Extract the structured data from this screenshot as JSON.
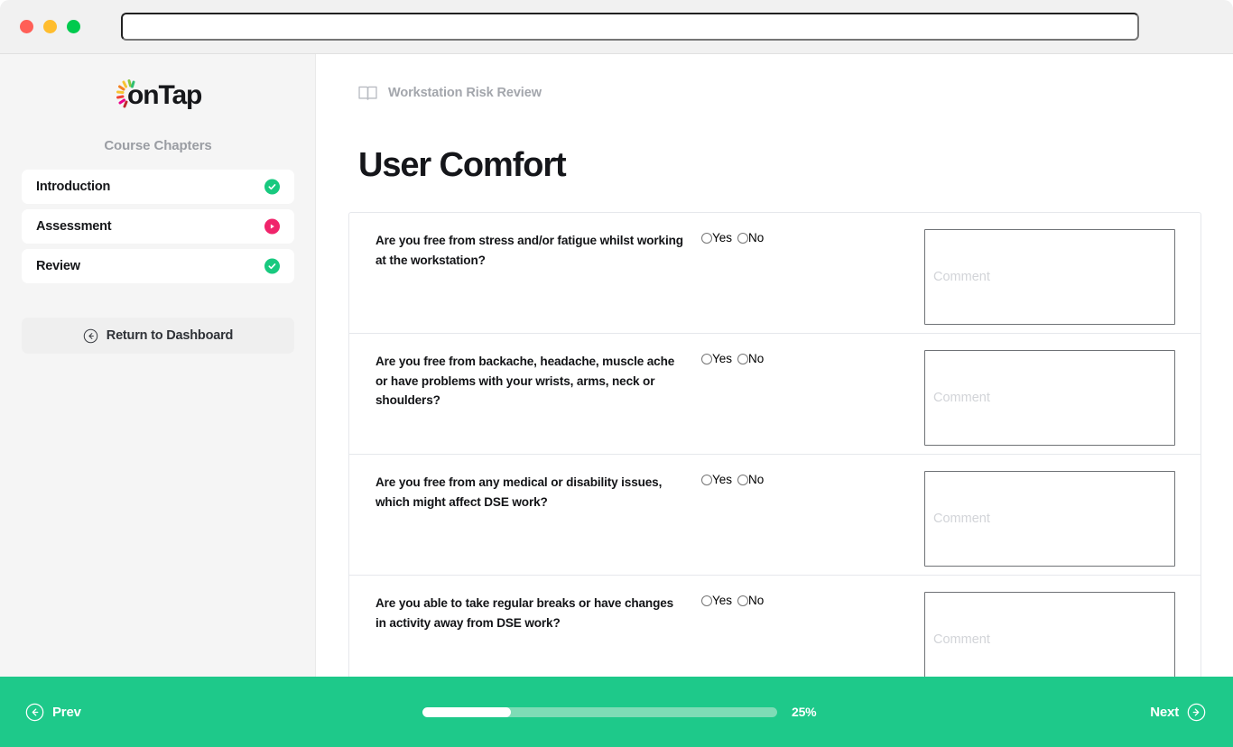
{
  "browser": {
    "traffic_lights": [
      {
        "name": "close",
        "color": "#FF5F57"
      },
      {
        "name": "minimize",
        "color": "#FFBD2E"
      },
      {
        "name": "maximize",
        "color": "#00CA4E"
      }
    ],
    "url_value": "",
    "url_placeholder": ""
  },
  "sidebar": {
    "logo_text": "onTap",
    "heading": "Course Chapters",
    "chapters": [
      {
        "label": "Introduction",
        "status": "complete",
        "status_icon": "check-circle-icon"
      },
      {
        "label": "Assessment",
        "status": "in-progress",
        "status_icon": "play-circle-icon"
      },
      {
        "label": "Review",
        "status": "complete",
        "status_icon": "check-circle-icon"
      }
    ],
    "return_label": "Return to Dashboard",
    "return_icon": "arrow-left-circle-icon"
  },
  "main": {
    "breadcrumb": "Workstation Risk Review",
    "breadcrumb_icon": "book-icon",
    "title": "User Comfort",
    "comment_placeholder": "Comment",
    "option_yes": "Yes",
    "option_no": "No",
    "questions": [
      {
        "text": "Are you free from stress and/or fatigue whilst working at the workstation?",
        "selected": "",
        "comment": ""
      },
      {
        "text": "Are you free from backache, headache, muscle ache or have problems with your wrists, arms, neck or shoulders?",
        "selected": "",
        "comment": ""
      },
      {
        "text": "Are you free from any medical or disability issues, which might affect DSE work?",
        "selected": "",
        "comment": ""
      },
      {
        "text": "Are you able to take regular breaks or have changes in activity away from DSE work?",
        "selected": "",
        "comment": ""
      }
    ]
  },
  "footer": {
    "prev_label": "Prev",
    "prev_icon": "arrow-left-circle-icon",
    "next_label": "Next",
    "next_icon": "arrow-right-circle-icon",
    "progress_percent_label": "25%",
    "progress_percent": 25,
    "accent_color": "#1ec98a",
    "track_color": "#7edcb6"
  }
}
